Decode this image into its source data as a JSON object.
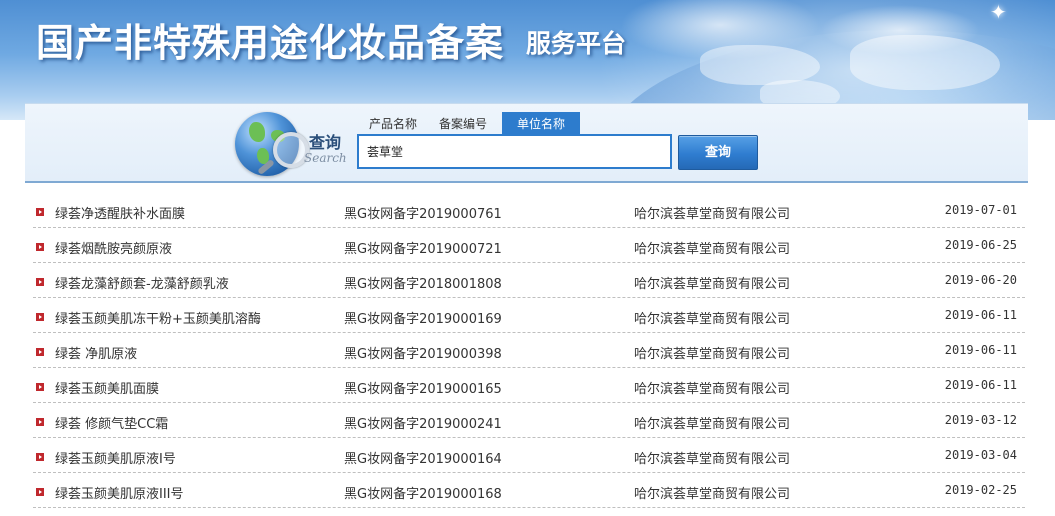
{
  "header": {
    "title": "国产非特殊用途化妆品备案",
    "subtitle": "服务平台"
  },
  "search": {
    "label_cn": "查询",
    "label_en": "Search",
    "tabs": [
      {
        "label": "产品名称",
        "active": false
      },
      {
        "label": "备案编号",
        "active": false
      },
      {
        "label": "单位名称",
        "active": true
      }
    ],
    "input_value": "荟草堂",
    "button_label": "查询"
  },
  "results": [
    {
      "name": "绿荟净透醒肤补水面膜",
      "record_no": "黑G妆网备字2019000761",
      "company": "哈尔滨荟草堂商贸有限公司",
      "date": "2019-07-01"
    },
    {
      "name": "绿荟烟酰胺亮颜原液",
      "record_no": "黑G妆网备字2019000721",
      "company": "哈尔滨荟草堂商贸有限公司",
      "date": "2019-06-25"
    },
    {
      "name": "绿荟龙藻舒颜套-龙藻舒颜乳液",
      "record_no": "黑G妆网备字2018001808",
      "company": "哈尔滨荟草堂商贸有限公司",
      "date": "2019-06-20"
    },
    {
      "name": "绿荟玉颜美肌冻干粉+玉颜美肌溶酶",
      "record_no": "黑G妆网备字2019000169",
      "company": "哈尔滨荟草堂商贸有限公司",
      "date": "2019-06-11"
    },
    {
      "name": "绿荟 净肌原液",
      "record_no": "黑G妆网备字2019000398",
      "company": "哈尔滨荟草堂商贸有限公司",
      "date": "2019-06-11"
    },
    {
      "name": "绿荟玉颜美肌面膜",
      "record_no": "黑G妆网备字2019000165",
      "company": "哈尔滨荟草堂商贸有限公司",
      "date": "2019-06-11"
    },
    {
      "name": "绿荟 修颜气垫CC霜",
      "record_no": "黑G妆网备字2019000241",
      "company": "哈尔滨荟草堂商贸有限公司",
      "date": "2019-03-12"
    },
    {
      "name": "绿荟玉颜美肌原液I号",
      "record_no": "黑G妆网备字2019000164",
      "company": "哈尔滨荟草堂商贸有限公司",
      "date": "2019-03-04"
    },
    {
      "name": "绿荟玉颜美肌原液III号",
      "record_no": "黑G妆网备字2019000168",
      "company": "哈尔滨荟草堂商贸有限公司",
      "date": "2019-02-25"
    }
  ],
  "colors": {
    "accent": "#2d7ccd",
    "bullet": "#c0282d",
    "banner": "#5d97d6"
  },
  "icons": {
    "search_logo": "globe-magnifier-icon",
    "row_bullet": "red-arrow-bullet-icon"
  }
}
